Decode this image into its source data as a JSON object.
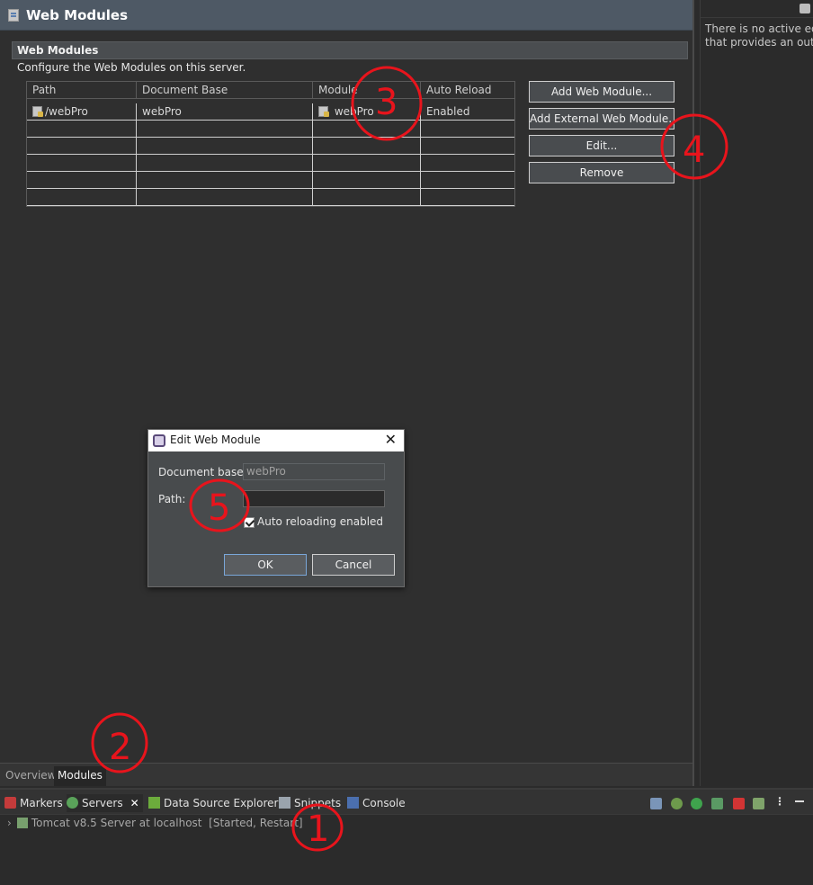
{
  "editor": {
    "title": "Web Modules",
    "section_title": "Web Modules",
    "section_desc": "Configure the Web Modules on this server."
  },
  "table": {
    "headers": [
      "Path",
      "Document Base",
      "Module",
      "Auto Reload"
    ],
    "rows": [
      {
        "path": "/webPro",
        "doc_base": "webPro",
        "module": "webPro",
        "auto_reload": "Enabled"
      }
    ]
  },
  "buttons": {
    "add_web_module": "Add Web Module...",
    "add_external": "Add External Web Module...",
    "edit": "Edit...",
    "remove": "Remove"
  },
  "editor_tabs": [
    "Overview",
    "Modules"
  ],
  "outline": {
    "message_line1": "There is no active editor",
    "message_line2": "that provides an outline."
  },
  "bottom": {
    "tabs": [
      "Markers",
      "Servers",
      "Data Source Explorer",
      "Snippets",
      "Console"
    ],
    "server_name": "Tomcat v8.5 Server at localhost",
    "server_state": "[Started, Restart]"
  },
  "dialog": {
    "title": "Edit Web Module",
    "doc_base_label": "Document base:",
    "doc_base_value": "webPro",
    "path_label": "Path:",
    "path_value": "",
    "auto_reload_label": "Auto reloading enabled",
    "auto_reload_checked": true,
    "ok": "OK",
    "cancel": "Cancel"
  },
  "annotations": [
    "1",
    "2",
    "3",
    "4",
    "5"
  ],
  "colors": {
    "annotation": "#e8141c",
    "header_bg": "#4e5965",
    "button_bg": "#494c4f"
  }
}
